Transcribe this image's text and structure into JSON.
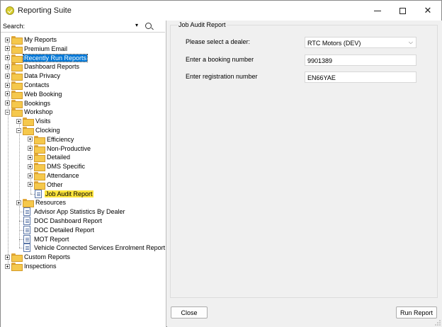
{
  "window": {
    "title": "Reporting Suite",
    "controls": {
      "minimize": "—",
      "maximize": "□",
      "close": "✕"
    }
  },
  "search": {
    "label": "Search:",
    "value": "",
    "dropdown_icon": "▾"
  },
  "tree": [
    {
      "label": "My Reports",
      "kind": "folder",
      "expander": "plus"
    },
    {
      "label": "Premium Email",
      "kind": "folder",
      "expander": "plus"
    },
    {
      "label": "Recently Run Reports",
      "kind": "folder",
      "expander": "plus",
      "selected": true
    },
    {
      "label": "Dashboard Reports",
      "kind": "folder",
      "expander": "plus"
    },
    {
      "label": "Data Privacy",
      "kind": "folder",
      "expander": "plus"
    },
    {
      "label": "Contacts",
      "kind": "folder",
      "expander": "plus"
    },
    {
      "label": "Web Booking",
      "kind": "folder",
      "expander": "plus"
    },
    {
      "label": "Bookings",
      "kind": "folder",
      "expander": "plus"
    },
    {
      "label": "Workshop",
      "kind": "folder",
      "expander": "minus"
    },
    {
      "label": "Visits",
      "kind": "folder",
      "expander": "plus"
    },
    {
      "label": "Clocking",
      "kind": "folder",
      "expander": "minus"
    },
    {
      "label": "Efficiency",
      "kind": "folder",
      "expander": "plus"
    },
    {
      "label": "Non-Productive",
      "kind": "folder",
      "expander": "plus"
    },
    {
      "label": "Detailed",
      "kind": "folder",
      "expander": "plus"
    },
    {
      "label": "DMS Specific",
      "kind": "folder",
      "expander": "plus"
    },
    {
      "label": "Attendance",
      "kind": "folder",
      "expander": "plus"
    },
    {
      "label": "Other",
      "kind": "folder",
      "expander": "plus"
    },
    {
      "label": "Job Audit Report",
      "kind": "report",
      "highlighted": true
    },
    {
      "label": "Resources",
      "kind": "folder",
      "expander": "plus"
    },
    {
      "label": "Advisor App Statistics By Dealer",
      "kind": "report"
    },
    {
      "label": "DOC Dashboard Report",
      "kind": "report"
    },
    {
      "label": "DOC Detailed Report",
      "kind": "report"
    },
    {
      "label": "MOT Report",
      "kind": "report"
    },
    {
      "label": "Vehicle Connected Services Enrolment Report",
      "kind": "report"
    },
    {
      "label": "Custom Reports",
      "kind": "folder",
      "expander": "plus"
    },
    {
      "label": "Inspections",
      "kind": "folder",
      "expander": "plus"
    }
  ],
  "panel": {
    "group_title": "Job Audit Report",
    "dealer": {
      "label": "Please select a dealer:",
      "value": "RTC Motors (DEV)"
    },
    "booking": {
      "label": "Enter a booking number",
      "value": "9901389"
    },
    "registration": {
      "label": "Enter registration number",
      "value": "EN66YAE"
    }
  },
  "buttons": {
    "close": "Close",
    "run": "Run Report"
  },
  "colors": {
    "selection": "#0078d7",
    "highlight": "#ffe43b",
    "folder": "#f5c84c"
  }
}
